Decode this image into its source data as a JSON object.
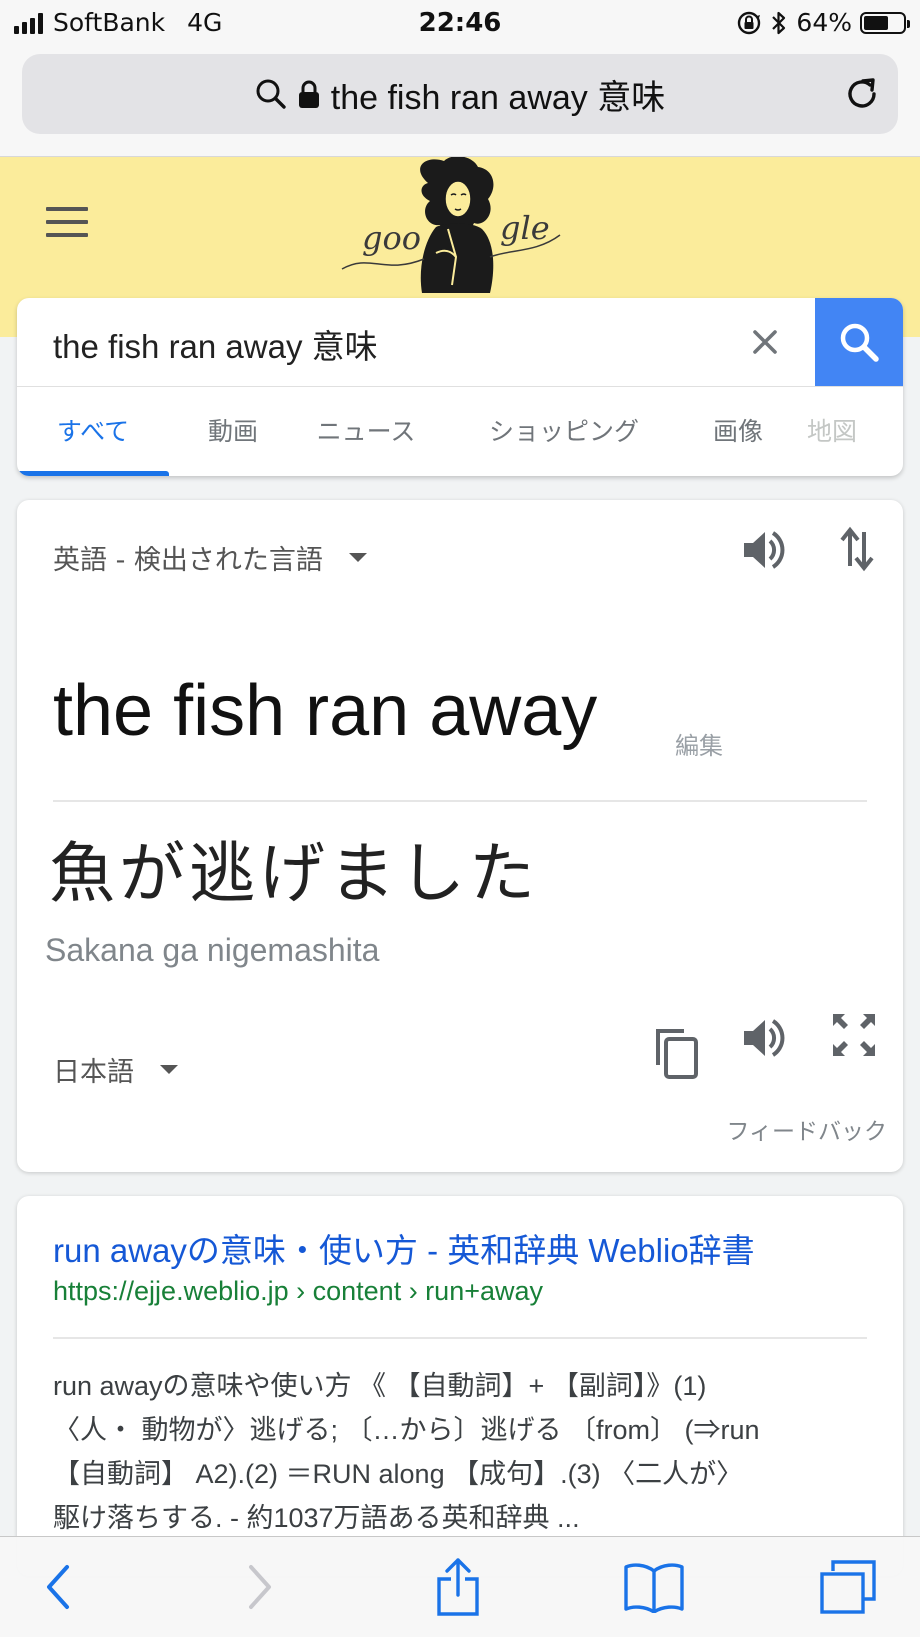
{
  "status_bar": {
    "carrier": "SoftBank",
    "network": "4G",
    "time": "22:46",
    "battery_percent": "64%",
    "battery_level": 0.64
  },
  "browser": {
    "address_text": "the fish ran away 意味",
    "icons": [
      "search-icon",
      "lock-icon",
      "reload-icon"
    ]
  },
  "google": {
    "logo_text_left": "goo",
    "logo_text_right": "gle",
    "search_query": "the fish ran away 意味",
    "tabs": [
      {
        "label": "すべて",
        "active": true
      },
      {
        "label": "動画",
        "active": false
      },
      {
        "label": "ニュース",
        "active": false
      },
      {
        "label": "ショッピング",
        "active": false
      },
      {
        "label": "画像",
        "active": false
      },
      {
        "label": "地図",
        "active": false
      }
    ],
    "accent_color": "#1a73e8",
    "search_button_color": "#4285f4",
    "header_color": "#fbec9b"
  },
  "translate": {
    "source_language": "英語 - 検出された言語",
    "source_text": "the fish ran away",
    "edit_label": "編集",
    "target_text": "魚が逃げました",
    "transliteration": "Sakana ga nigemashita",
    "target_language": "日本語",
    "feedback_label": "フィードバック"
  },
  "result": {
    "title": "run awayの意味・使い方 - 英和辞典 Weblio辞書",
    "url": "https://ejje.weblio.jp › content › run+away",
    "snippet_lines": [
      "run awayの意味や使い方 《 【自動詞】+ 【副詞】》(1)",
      "〈人・ 動物が〉逃げる; 〔…から〕逃げる 〔from〕 (⇒run",
      "【自動詞】 A2).(2) ＝RUN along 【成句】.(3) 〈二人が〉",
      "駆け落ちする. - 約1037万語ある英和辞典 ..."
    ]
  }
}
